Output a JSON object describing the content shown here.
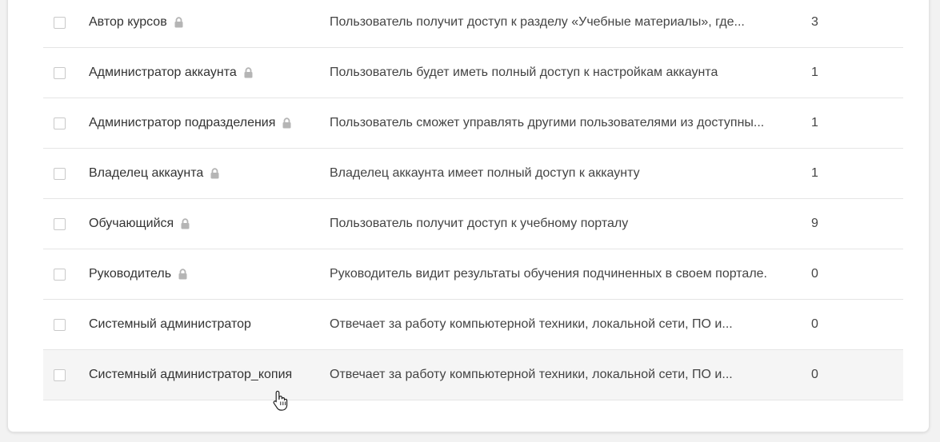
{
  "roles_table": {
    "rows": [
      {
        "name": "Автор курсов",
        "locked": true,
        "description": "Пользователь получит доступ к разделу «Учебные материалы», где...",
        "count": "3"
      },
      {
        "name": "Администратор аккаунта",
        "locked": true,
        "description": "Пользователь будет иметь полный доступ к настройкам аккаунта",
        "count": "1"
      },
      {
        "name": "Администратор подразделения",
        "locked": true,
        "description": "Пользователь сможет управлять другими пользователями из доступны...",
        "count": "1"
      },
      {
        "name": "Владелец аккаунта",
        "locked": true,
        "description": "Владелец аккаунта имеет полный доступ к аккаунту",
        "count": "1"
      },
      {
        "name": "Обучающийся",
        "locked": true,
        "description": "Пользователь получит доступ к учебному порталу",
        "count": "9"
      },
      {
        "name": "Руководитель",
        "locked": true,
        "description": "Руководитель видит результаты обучения подчиненных в своем портале.",
        "count": "0"
      },
      {
        "name": "Системный администратор",
        "locked": false,
        "description": "Отвечает за работу компьютерной техники, локальной сети, ПО и...",
        "count": "0"
      },
      {
        "name": "Системный администратор_копия",
        "locked": false,
        "description": "Отвечает за работу компьютерной техники, локальной сети, ПО и...",
        "count": "0",
        "hovered": true
      }
    ]
  },
  "icons": {
    "lock": "lock-icon",
    "cursor": "hand-pointer-cursor"
  },
  "colors": {
    "row_hover": "#f5f5f5",
    "lock_icon": "#b5b5b5",
    "divider": "#e5e5e5"
  }
}
